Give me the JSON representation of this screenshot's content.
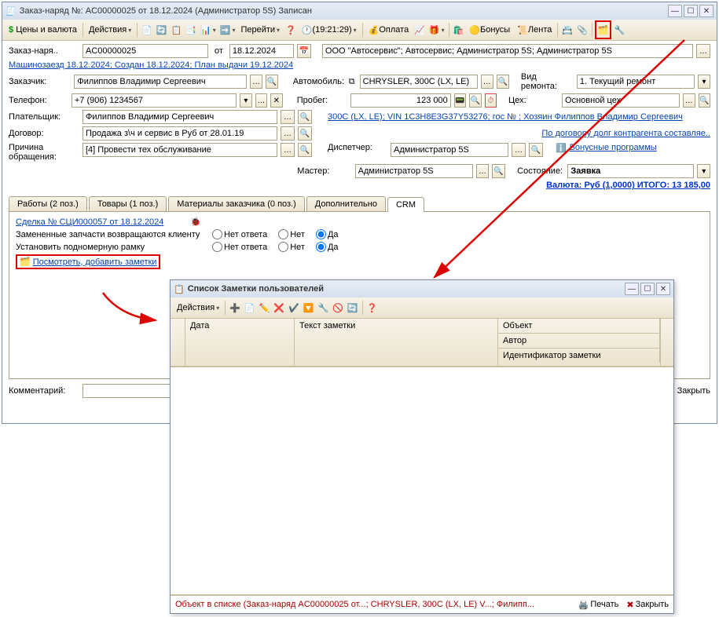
{
  "window": {
    "title": "Заказ-наряд №: AC00000025 от 18.12.2024 (Администратор 5S) Записан"
  },
  "toolbar": {
    "prices": "Цены и валюта",
    "actions": "Действия",
    "go": "Перейти",
    "time": "(19:21:29)",
    "pay": "Оплата",
    "bonus": "Бонусы",
    "lenta": "Лента"
  },
  "hdr": {
    "lbl_order": "Заказ-наря..",
    "order_no": "AC00000025",
    "lbl_ot": "от",
    "date": "18.12.2024",
    "org": "ООО \"Автосервис\"; Автосервис; Администратор 5S; Администратор 5S",
    "trace": "Машинозаезд 18.12.2024; Создан 18.12.2024; План выдачи 19.12.2024",
    "lbl_customer": "Заказчик:",
    "customer": "Филиппов Владимир Сергеевич",
    "lbl_phone": "Телефон:",
    "phone": "+7 (906) 1234567",
    "lbl_payer": "Плательщик:",
    "payer": "Филиппов Владимир Сергеевич",
    "lbl_contract": "Договор:",
    "contract": "Продажа з\\ч и сервис в Руб от 28.01.19",
    "lbl_reason": "Причина обращения:",
    "reason": "[4] Провести тех обслуживание",
    "lbl_auto": "Автомобиль:",
    "auto": "CHRYSLER, 300C (LX, LE)",
    "lbl_repair": "Вид ремонта:",
    "repair": "1. Текущий ремонт",
    "lbl_mileage": "Пробег:",
    "mileage": "123 000",
    "lbl_shop": "Цех:",
    "shop": "Основной цех",
    "vin_link": "300C (LX, LE); VIN 1C3H8E3G37Y53276; гос № ; Хозяин Филиппов Владимир Сергеевич",
    "debt_link": "По договору долг контрагента составляе..",
    "lbl_disp": "Диспетчер:",
    "disp": "Администратор 5S",
    "bonus_link": "Бонусные программы",
    "lbl_master": "Мастер:",
    "master": "Администратор 5S",
    "lbl_state": "Состояние:",
    "state": "Заявка",
    "total": "Валюта: Руб (1,0000) ИТОГО: 13 185,00"
  },
  "tabs": {
    "t1": "Работы (2 поз.)",
    "t2": "Товары (1 поз.)",
    "t3": "Материалы заказчика (0 поз.)",
    "t4": "Дополнительно",
    "t5": "CRM"
  },
  "crm": {
    "deal_link": "Сделка № СЦИ000057 от 18.12.2024",
    "q1": "Замененные запчасти возвращаются клиенту",
    "q2": "Установить подномерную рамку",
    "opt1": "Нет ответа",
    "opt2": "Нет",
    "opt3": "Да",
    "view_notes": "Посмотреть, добавить заметки"
  },
  "footer": {
    "lbl_comment": "Комментарий:",
    "close": "Закрыть"
  },
  "subwin": {
    "title": "Список Заметки пользователей",
    "actions": "Действия",
    "col_date": "Дата",
    "col_text": "Текст заметки",
    "col_obj": "Объект",
    "col_author": "Автор",
    "col_id": "Идентификатор заметки",
    "status": "Объект в списке (Заказ-наряд AC00000025 от...; CHRYSLER, 300C (LX, LE) V...; Филипп...",
    "print": "Печать",
    "close": "Закрыть"
  }
}
